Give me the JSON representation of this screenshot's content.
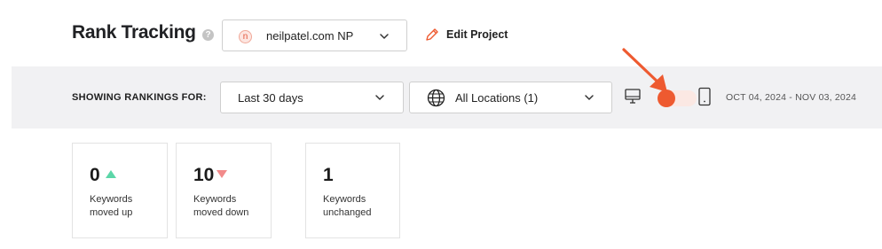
{
  "header": {
    "title": "Rank Tracking",
    "help_icon": "question-circle-icon",
    "project": {
      "favicon_letter": "n",
      "label": "neilpatel.com NP"
    },
    "edit_project_label": "Edit Project"
  },
  "filters": {
    "showing_label": "SHOWING RANKINGS FOR:",
    "period": "Last 30 days",
    "location": "All Locations (1)",
    "device_toggle": {
      "left_icon": "desktop-icon",
      "right_icon": "mobile-icon",
      "selected": "desktop"
    },
    "date_range": "OCT 04, 2024 - NOV 03, 2024"
  },
  "stats": [
    {
      "value": "0",
      "trend": "up",
      "label_line1": "Keywords",
      "label_line2": "moved up"
    },
    {
      "value": "10",
      "trend": "down",
      "label_line1": "Keywords",
      "label_line2": "moved down"
    },
    {
      "value": "1",
      "trend": "none",
      "label_line1": "Keywords",
      "label_line2": "unchanged"
    }
  ],
  "colors": {
    "accent": "#EE5A30",
    "up": "#5CD6A8",
    "down": "#F28B8B",
    "filter_bg": "#F1F1F3"
  }
}
